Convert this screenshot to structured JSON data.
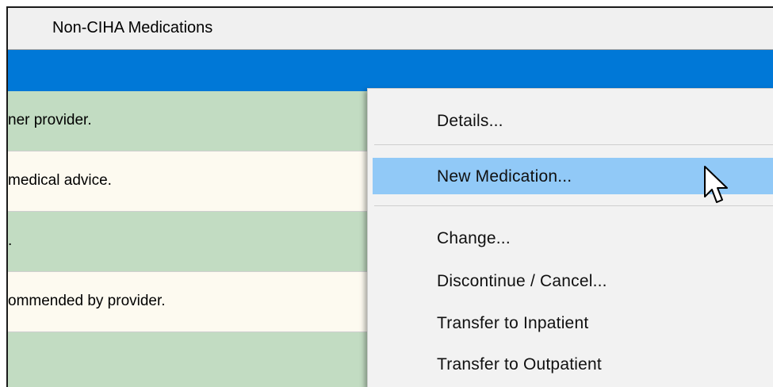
{
  "header": {
    "tab_label": "Non-CIHA Medications"
  },
  "rows": [
    {
      "text": "ner provider.",
      "color": "#c2dcc2"
    },
    {
      "text": " medical advice.",
      "color": "#fdfaf0"
    },
    {
      "text": ".",
      "color": "#c2dcc2"
    },
    {
      "text": "ommended by provider.",
      "color": "#fdfaf0"
    },
    {
      "text": "",
      "color": "#c2dcc2"
    }
  ],
  "context_menu": {
    "items": [
      {
        "label": "Details..."
      },
      {
        "label": "New Medication...",
        "highlighted": true
      },
      {
        "label": "Change..."
      },
      {
        "label": "Discontinue / Cancel..."
      },
      {
        "label": "Transfer to Inpatient"
      },
      {
        "label": "Transfer to Outpatient"
      }
    ]
  },
  "colors": {
    "selection_blue": "#0078d7",
    "menu_highlight": "#91c9f7",
    "row_green": "#c2dcc2",
    "row_cream": "#fdfaf0"
  },
  "cursor": {
    "icon": "arrow-cursor-icon"
  }
}
